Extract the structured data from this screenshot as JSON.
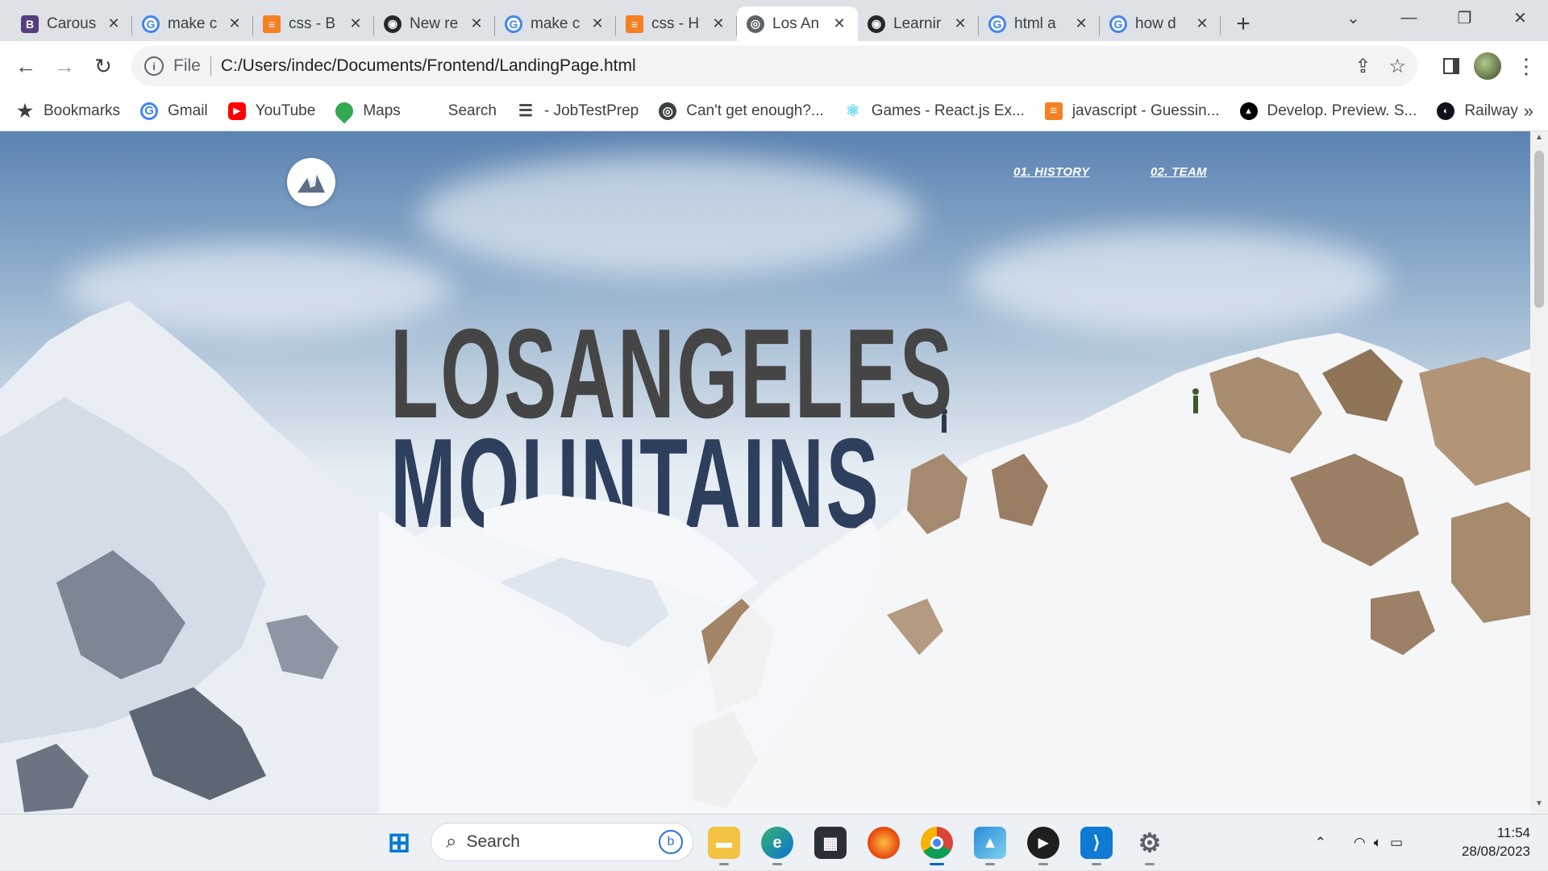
{
  "browser": {
    "tabs": [
      {
        "title": "Carous",
        "icon": "bootstrap-icon",
        "active": false
      },
      {
        "title": "make c",
        "icon": "google-icon",
        "active": false
      },
      {
        "title": "css - B",
        "icon": "stackoverflow-icon",
        "active": false
      },
      {
        "title": "New re",
        "icon": "github-icon",
        "active": false
      },
      {
        "title": "make c",
        "icon": "google-icon",
        "active": false
      },
      {
        "title": "css - H",
        "icon": "stackoverflow-icon",
        "active": false
      },
      {
        "title": "Los An",
        "icon": "globe-icon",
        "active": true
      },
      {
        "title": "Learnir",
        "icon": "github-icon",
        "active": false
      },
      {
        "title": "html a",
        "icon": "google-icon",
        "active": false
      },
      {
        "title": "how d",
        "icon": "google-icon",
        "active": false
      }
    ],
    "address": {
      "scheme": "File",
      "url": "C:/Users/indec/Documents/Frontend/LandingPage.html"
    },
    "bookmarks": [
      {
        "label": "Bookmarks",
        "icon": "star-icon"
      },
      {
        "label": "Gmail",
        "icon": "google-icon"
      },
      {
        "label": "YouTube",
        "icon": "youtube-icon"
      },
      {
        "label": "Maps",
        "icon": "maps-icon"
      },
      {
        "label": "Search",
        "icon": "blank-icon"
      },
      {
        "label": "- JobTestPrep",
        "icon": "menu-icon"
      },
      {
        "label": "Can't get enough?...",
        "icon": "globe-icon"
      },
      {
        "label": "Games - React.js Ex...",
        "icon": "react-icon"
      },
      {
        "label": "javascript - Guessin...",
        "icon": "stackoverflow-icon"
      },
      {
        "label": "Develop. Preview. S...",
        "icon": "vercel-icon"
      },
      {
        "label": "Railway",
        "icon": "railway-icon"
      }
    ]
  },
  "page": {
    "nav": [
      {
        "label": "01. HISTORY"
      },
      {
        "label": "02. TEAM"
      }
    ],
    "hero": {
      "line1": "LOSANGELES",
      "line2": "MOUNTAINS"
    }
  },
  "taskbar": {
    "search_placeholder": "Search",
    "apps": [
      "windows-start-icon",
      "file-explorer-icon",
      "edge-icon",
      "store-icon",
      "firefox-icon",
      "chrome-icon",
      "photos-icon",
      "media-player-icon",
      "vscode-icon",
      "settings-icon"
    ],
    "clock": {
      "time": "11:54",
      "date": "28/08/2023"
    }
  },
  "colors": {
    "title_gray": "#454545",
    "title_navy": "#2e3f5e",
    "chrome_tab_bg": "#dee1e6"
  }
}
